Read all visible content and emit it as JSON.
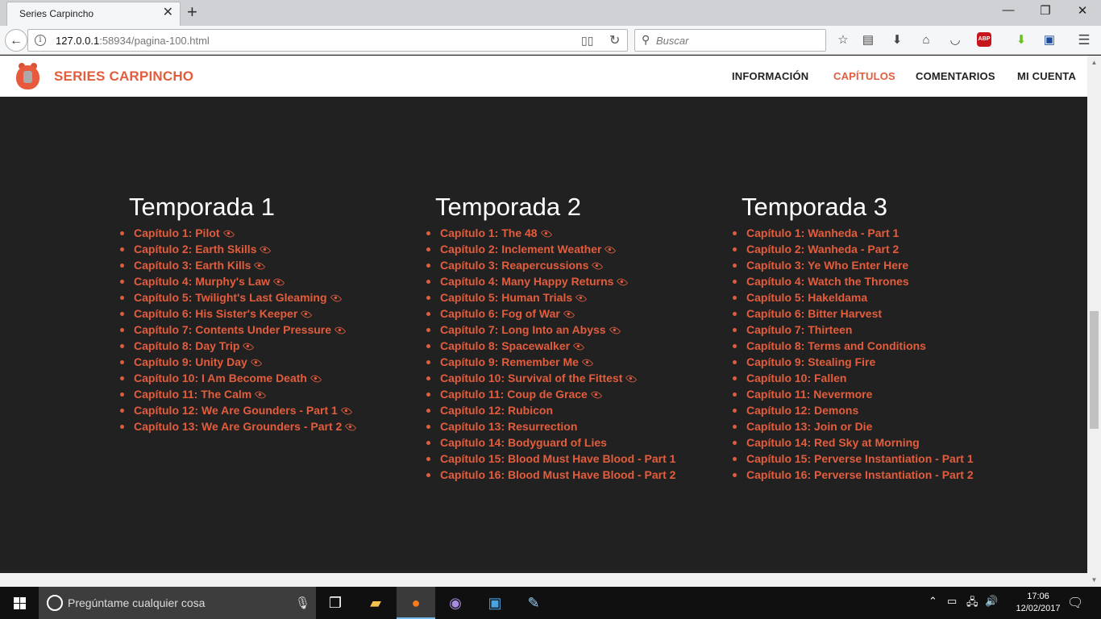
{
  "browser": {
    "tab_title": "Series Carpincho",
    "tab_close": "✕",
    "new_tab": "+",
    "url_host": "127.0.0.1",
    "url_rest": ":58934/pagina-100.html",
    "search_placeholder": "Buscar",
    "win_minimize": "—",
    "win_maximize": "❐",
    "win_close": "✕",
    "toolbar_icons": [
      "bookmark-star-icon",
      "library-icon",
      "downloads-icon",
      "home-icon",
      "pocket-icon",
      "adblock-plus-icon",
      "download-helper-icon",
      "extension-icon",
      "menu-icon"
    ],
    "adblock_label": "ABP"
  },
  "site": {
    "brand": "SERIES CARPINCHO",
    "menu": [
      {
        "label": "INFORMACIÓN",
        "active": false
      },
      {
        "label": "CAPÍTULOS",
        "active": true
      },
      {
        "label": "COMENTARIOS",
        "active": false
      },
      {
        "label": "MI CUENTA",
        "active": false
      }
    ],
    "accent_color": "#e35d3d"
  },
  "seasons": [
    {
      "title": "Temporada 1",
      "episodes": [
        {
          "label": "Capítulo 1: Pilot",
          "watched": true
        },
        {
          "label": "Capítulo 2: Earth Skills",
          "watched": true
        },
        {
          "label": "Capítulo 3: Earth Kills",
          "watched": true
        },
        {
          "label": "Capítulo 4: Murphy's Law",
          "watched": true
        },
        {
          "label": "Capítulo 5: Twilight's Last Gleaming",
          "watched": true
        },
        {
          "label": "Capítulo 6: His Sister's Keeper",
          "watched": true
        },
        {
          "label": "Capítulo 7: Contents Under Pressure",
          "watched": true
        },
        {
          "label": "Capítulo 8: Day Trip",
          "watched": true
        },
        {
          "label": "Capítulo 9: Unity Day",
          "watched": true
        },
        {
          "label": "Capítulo 10: I Am Become Death",
          "watched": true
        },
        {
          "label": "Capítulo 11: The Calm",
          "watched": true
        },
        {
          "label": "Capítulo 12: We Are Gounders - Part 1",
          "watched": true
        },
        {
          "label": "Capítulo 13: We Are Grounders - Part 2",
          "watched": true
        }
      ]
    },
    {
      "title": "Temporada 2",
      "episodes": [
        {
          "label": "Capítulo 1: The 48",
          "watched": true
        },
        {
          "label": "Capítulo 2: Inclement Weather",
          "watched": true
        },
        {
          "label": "Capítulo 3: Reapercussions",
          "watched": true
        },
        {
          "label": "Capítulo 4: Many Happy Returns",
          "watched": true
        },
        {
          "label": "Capítulo 5: Human Trials",
          "watched": true
        },
        {
          "label": "Capítulo 6: Fog of War",
          "watched": true
        },
        {
          "label": "Capítulo 7: Long Into an Abyss",
          "watched": true
        },
        {
          "label": "Capítulo 8: Spacewalker",
          "watched": true
        },
        {
          "label": "Capítulo 9: Remember Me",
          "watched": true
        },
        {
          "label": "Capítulo 10: Survival of the Fittest",
          "watched": true
        },
        {
          "label": "Capítulo 11: Coup de Grace",
          "watched": true
        },
        {
          "label": "Capítulo 12: Rubicon",
          "watched": false
        },
        {
          "label": "Capítulo 13: Resurrection",
          "watched": false
        },
        {
          "label": "Capítulo 14: Bodyguard of Lies",
          "watched": false
        },
        {
          "label": "Capítulo 15: Blood Must Have Blood - Part 1",
          "watched": false
        },
        {
          "label": "Capítulo 16: Blood Must Have Blood - Part 2",
          "watched": false
        }
      ]
    },
    {
      "title": "Temporada 3",
      "episodes": [
        {
          "label": "Capítulo 1: Wanheda - Part 1",
          "watched": false
        },
        {
          "label": "Capítulo 2: Wanheda - Part 2",
          "watched": false
        },
        {
          "label": "Capítulo 3: Ye Who Enter Here",
          "watched": false
        },
        {
          "label": "Capítulo 4: Watch the Thrones",
          "watched": false
        },
        {
          "label": "Capítulo 5: Hakeldama",
          "watched": false
        },
        {
          "label": "Capítulo 6: Bitter Harvest",
          "watched": false
        },
        {
          "label": "Capítulo 7: Thirteen",
          "watched": false
        },
        {
          "label": "Capítulo 8: Terms and Conditions",
          "watched": false
        },
        {
          "label": "Capítulo 9: Stealing Fire",
          "watched": false
        },
        {
          "label": "Capítulo 10: Fallen",
          "watched": false
        },
        {
          "label": "Capítulo 11: Nevermore",
          "watched": false
        },
        {
          "label": "Capítulo 12: Demons",
          "watched": false
        },
        {
          "label": "Capítulo 13: Join or Die",
          "watched": false
        },
        {
          "label": "Capítulo 14: Red Sky at Morning",
          "watched": false
        },
        {
          "label": "Capítulo 15: Perverse Instantiation - Part 1",
          "watched": false
        },
        {
          "label": "Capítulo 16: Perverse Instantiation - Part 2",
          "watched": false
        }
      ]
    }
  ],
  "taskbar": {
    "search_placeholder": "Pregúntame cualquier cosa",
    "apps": [
      "task-view-icon",
      "file-explorer-icon",
      "firefox-icon",
      "purple-app-icon",
      "blue-app-icon",
      "paint-icon"
    ],
    "time": "17:06",
    "date": "12/02/2017"
  }
}
